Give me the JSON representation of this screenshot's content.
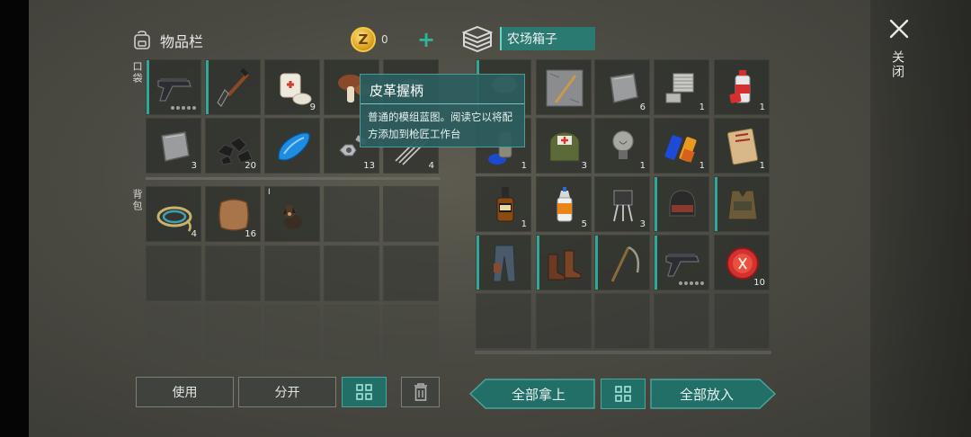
{
  "inventory": {
    "title": "物品栏",
    "coin_symbol": "Z",
    "coins": "0",
    "add_symbol": "+"
  },
  "sections": {
    "pocket": "口袋",
    "backpack": "背包"
  },
  "box": {
    "name": "农场箱子"
  },
  "close": {
    "label": "关闭"
  },
  "tooltip": {
    "title": "皮革握柄",
    "description": "普通的模组蓝图。阅读它以将配方添加到枪匠工作台"
  },
  "buttons": {
    "use": "使用",
    "split": "分开",
    "take_all": "全部拿上",
    "put_all": "全部放入"
  },
  "pocket_items": [
    {
      "name": "pistol",
      "qty": ""
    },
    {
      "name": "shovel",
      "qty": ""
    },
    {
      "name": "bandage",
      "qty": "9"
    },
    {
      "name": "mushroom",
      "qty": ""
    },
    {
      "name": "metal-part",
      "qty": ""
    },
    {
      "name": "iron-plate",
      "qty": "3"
    },
    {
      "name": "coal",
      "qty": "20"
    },
    {
      "name": "fuel-tank",
      "qty": ""
    },
    {
      "name": "nut-bolt",
      "qty": "13"
    },
    {
      "name": "wire",
      "qty": "4"
    }
  ],
  "backpack_items": [
    {
      "name": "rope",
      "qty": "4",
      "pre": ""
    },
    {
      "name": "leather",
      "qty": "16",
      "pre": ""
    },
    {
      "name": "dog",
      "qty": "",
      "pre": "I"
    }
  ],
  "box_items": [
    {
      "name": "stone",
      "qty": ""
    },
    {
      "name": "blueprint",
      "qty": ""
    },
    {
      "name": "iron-plate",
      "qty": "6"
    },
    {
      "name": "engine-part",
      "qty": "1"
    },
    {
      "name": "spray-can",
      "qty": "1"
    },
    {
      "name": "cans",
      "qty": "1"
    },
    {
      "name": "medkit-bag",
      "qty": "3"
    },
    {
      "name": "light-bulb",
      "qty": "1"
    },
    {
      "name": "batteries",
      "qty": "1"
    },
    {
      "name": "notebook",
      "qty": "1"
    },
    {
      "name": "whiskey",
      "qty": "1"
    },
    {
      "name": "glue",
      "qty": "5"
    },
    {
      "name": "transistor",
      "qty": "3"
    },
    {
      "name": "helmet",
      "qty": ""
    },
    {
      "name": "armor-vest",
      "qty": ""
    },
    {
      "name": "pants",
      "qty": ""
    },
    {
      "name": "boots",
      "qty": ""
    },
    {
      "name": "scythe",
      "qty": ""
    },
    {
      "name": "pistol",
      "qty": ""
    },
    {
      "name": "bottle-cap",
      "qty": "10"
    }
  ]
}
